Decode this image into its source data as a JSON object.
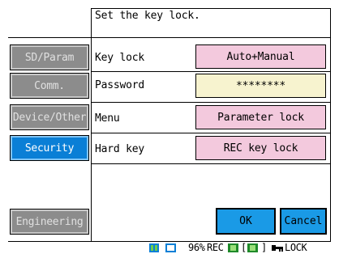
{
  "header": {
    "title": "Set the key lock."
  },
  "sidebar": {
    "items": [
      {
        "label": "SD/Param",
        "active": false
      },
      {
        "label": "Comm.",
        "active": false
      },
      {
        "label": "Device/Other",
        "active": false
      },
      {
        "label": "Security",
        "active": true
      },
      {
        "label": "Engineering",
        "active": false
      }
    ]
  },
  "settings": {
    "key_lock": {
      "label": "Key lock",
      "value": "Auto+Manual"
    },
    "password": {
      "label": "Password",
      "value": "********"
    },
    "menu": {
      "label": "Menu",
      "value": "Parameter lock"
    },
    "hard_key": {
      "label": "Hard key",
      "value": "REC key lock"
    }
  },
  "actions": {
    "ok_label": "OK",
    "cancel_label": "Cancel"
  },
  "status": {
    "memory_percent": "96%",
    "rec_label": "REC",
    "bracket_open": "[",
    "bracket_close": "]",
    "lock_label": "LOCK",
    "icons": [
      "battery-icon",
      "sd-card-icon",
      "m-icon",
      "s-icon",
      "key-icon"
    ]
  },
  "colors": {
    "active_tab": "#0a7fd6",
    "inactive_tab": "#8c8c8c",
    "value_button": "#f3c9dd",
    "password_field": "#f7f3cf",
    "action_button": "#1a9ae6"
  }
}
